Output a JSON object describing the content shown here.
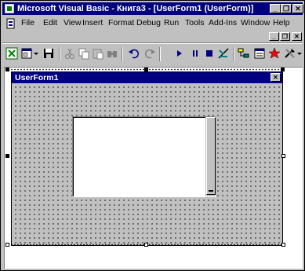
{
  "window": {
    "title": "Microsoft Visual Basic - Книга3 - [UserForm1 (UserForm)]",
    "minimize_glyph": "_",
    "restore_glyph": "❐",
    "close_glyph": "✕"
  },
  "menubar": {
    "items": [
      {
        "id": "file",
        "label": "File"
      },
      {
        "id": "edit",
        "label": "Edit"
      },
      {
        "id": "view",
        "label": "View"
      },
      {
        "id": "insert",
        "label": "Insert"
      },
      {
        "id": "format",
        "label": "Format"
      },
      {
        "id": "debug",
        "label": "Debug"
      },
      {
        "id": "run",
        "label": "Run"
      },
      {
        "id": "tools",
        "label": "Tools"
      },
      {
        "id": "addins",
        "label": "Add-Ins"
      },
      {
        "id": "window",
        "label": "Window"
      },
      {
        "id": "help",
        "label": "Help"
      }
    ]
  },
  "toolbar": {
    "buttons": [
      "excel-icon",
      "insert-userform-icon",
      "save-icon",
      "cut-icon",
      "copy-icon",
      "paste-icon",
      "find-icon",
      "undo-icon",
      "redo-icon",
      "run-icon",
      "break-icon",
      "reset-icon",
      "design-mode-icon",
      "project-explorer-icon",
      "properties-icon",
      "object-browser-icon",
      "toolbox-icon"
    ]
  },
  "form": {
    "title": "UserForm1",
    "close_glyph": "✕"
  },
  "colors": {
    "titlebar": "#000080",
    "face": "#c0c0c0",
    "window_bg": "#ffffff"
  }
}
